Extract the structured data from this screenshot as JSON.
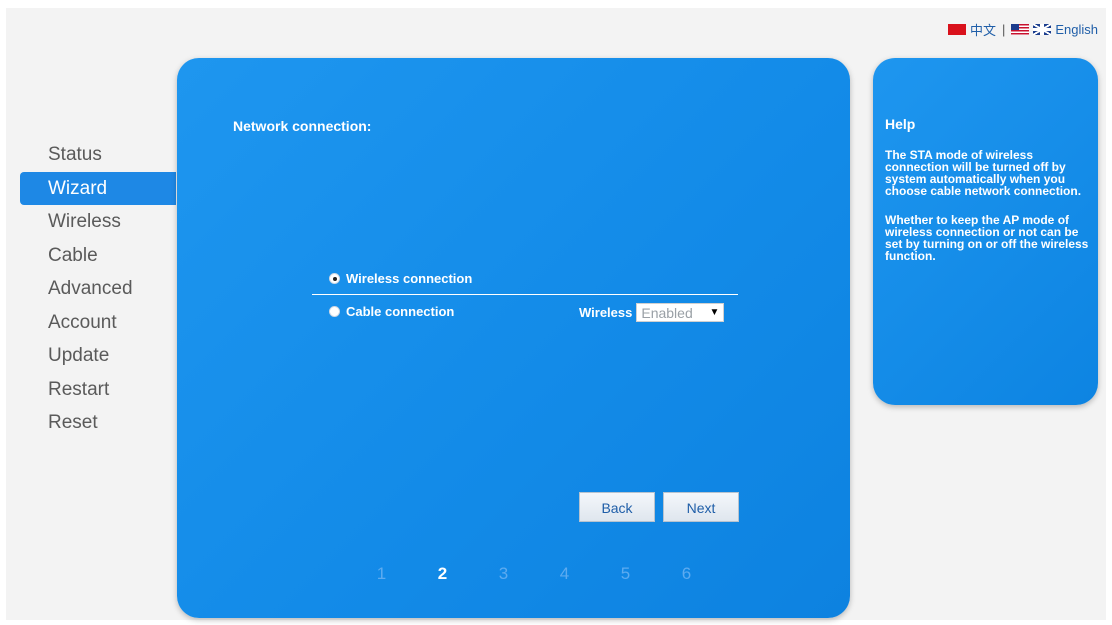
{
  "language": {
    "chinese": "中文",
    "separator": "|",
    "english": "English"
  },
  "sidebar": {
    "items": [
      {
        "label": "Status",
        "active": false
      },
      {
        "label": "Wizard",
        "active": true
      },
      {
        "label": "Wireless",
        "active": false
      },
      {
        "label": "Cable",
        "active": false
      },
      {
        "label": "Advanced",
        "active": false
      },
      {
        "label": "Account",
        "active": false
      },
      {
        "label": "Update",
        "active": false
      },
      {
        "label": "Restart",
        "active": false
      },
      {
        "label": "Reset",
        "active": false
      }
    ]
  },
  "main": {
    "title": "Network connection:",
    "options": [
      {
        "label": "Wireless connection",
        "checked": true
      },
      {
        "label": "Cable connection",
        "checked": false
      }
    ],
    "wireless_label": "Wireless",
    "wireless_select": {
      "value": "Enabled"
    },
    "back_label": "Back",
    "next_label": "Next",
    "steps": [
      "1",
      "2",
      "3",
      "4",
      "5",
      "6"
    ],
    "current_step": "2"
  },
  "help": {
    "title": "Help",
    "paragraphs": [
      "The STA mode of wireless connection will be turned off by system automatically when you choose cable network connection.",
      "Whether to keep the AP mode of wireless connection or not can be set by turning on or off the wireless function."
    ]
  },
  "colors": {
    "panel_blue": "#138be8",
    "active_nav": "#1e88e5",
    "background": "#f3f3f3"
  }
}
